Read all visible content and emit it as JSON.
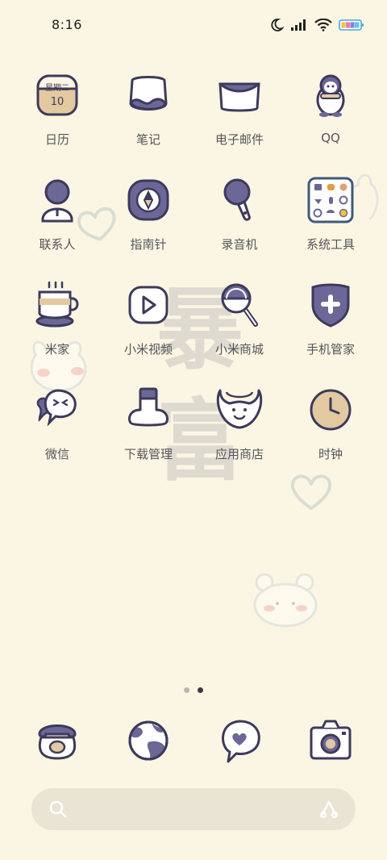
{
  "status_bar": {
    "time": "8:16",
    "icons": [
      "moon-icon",
      "signal-icon",
      "wifi-icon",
      "battery-icon"
    ]
  },
  "watermark": {
    "text": "暴富"
  },
  "apps": [
    {
      "label": "日历",
      "icon": "calendar-icon",
      "calendar_line1": "星期二",
      "calendar_day": "10"
    },
    {
      "label": "笔记",
      "icon": "notes-icon"
    },
    {
      "label": "电子邮件",
      "icon": "mail-icon"
    },
    {
      "label": "QQ",
      "icon": "penguin-icon"
    },
    {
      "label": "联系人",
      "icon": "contacts-icon"
    },
    {
      "label": "指南针",
      "icon": "compass-icon"
    },
    {
      "label": "录音机",
      "icon": "microphone-icon"
    },
    {
      "label": "系统工具",
      "icon": "folder-icon"
    },
    {
      "label": "米家",
      "icon": "coffee-cup-icon"
    },
    {
      "label": "小米视频",
      "icon": "play-icon"
    },
    {
      "label": "小米商城",
      "icon": "lollipop-icon"
    },
    {
      "label": "手机管家",
      "icon": "shield-plus-icon"
    },
    {
      "label": "微信",
      "icon": "chat-bubbles-icon"
    },
    {
      "label": "下载管理",
      "icon": "download-box-icon"
    },
    {
      "label": "应用商店",
      "icon": "bib-smile-icon"
    },
    {
      "label": "时钟",
      "icon": "clock-icon"
    }
  ],
  "page_indicator": {
    "count": 2,
    "active": 2
  },
  "dock": [
    {
      "icon": "phone-icon"
    },
    {
      "icon": "browser-globe-icon"
    },
    {
      "icon": "message-heart-icon"
    },
    {
      "icon": "camera-icon"
    }
  ],
  "search": {
    "left_icon": "search-icon",
    "right_icon": "assistant-icon"
  },
  "colors": {
    "background": "#fbf6e3",
    "accent_purple": "#6b6796",
    "outline": "#3d3a5c",
    "tan": "#e3c9a0"
  }
}
